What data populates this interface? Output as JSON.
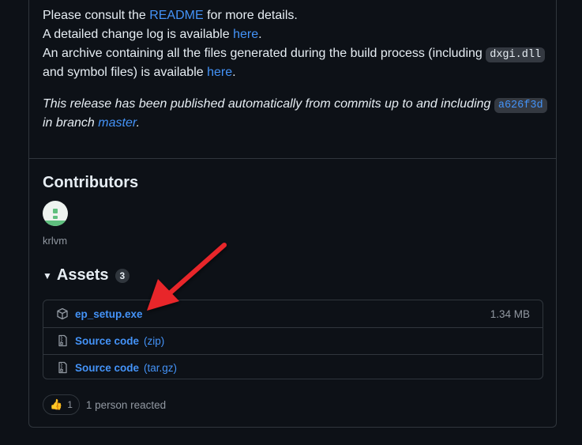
{
  "notes": {
    "line1_pre": "Please consult the ",
    "line1_link": "README",
    "line1_post": " for more details.",
    "line2_pre": "A detailed change log is available ",
    "line2_link": "here",
    "line2_post": ".",
    "line3_pre": "An archive containing all the files generated during the build process (including ",
    "line3_code": "dxgi.dll",
    "line4_pre": "and symbol files) is available ",
    "line4_link": "here",
    "line4_post": ".",
    "auto_pre": "This release has been published automatically from commits up to and including ",
    "auto_commit": "a626f3d",
    "branch_pre": "in branch ",
    "branch_link": "master",
    "branch_post": "."
  },
  "contributors": {
    "title": "Contributors",
    "username": "krlvm"
  },
  "assets": {
    "title": "Assets",
    "count": "3",
    "items": [
      {
        "name": "ep_setup.exe",
        "ext": "",
        "size": "1.34 MB",
        "icon": "package-icon"
      },
      {
        "name": "Source code",
        "ext": "(zip)",
        "size": "",
        "icon": "file-zip-icon"
      },
      {
        "name": "Source code",
        "ext": "(tar.gz)",
        "size": "",
        "icon": "file-zip-icon"
      }
    ]
  },
  "reactions": {
    "emoji": "👍",
    "count": "1",
    "summary": "1 person reacted"
  },
  "colors": {
    "background": "#0d1117",
    "link": "#4493f8",
    "border": "#30363d",
    "annotation_arrow": "#e8262b"
  }
}
